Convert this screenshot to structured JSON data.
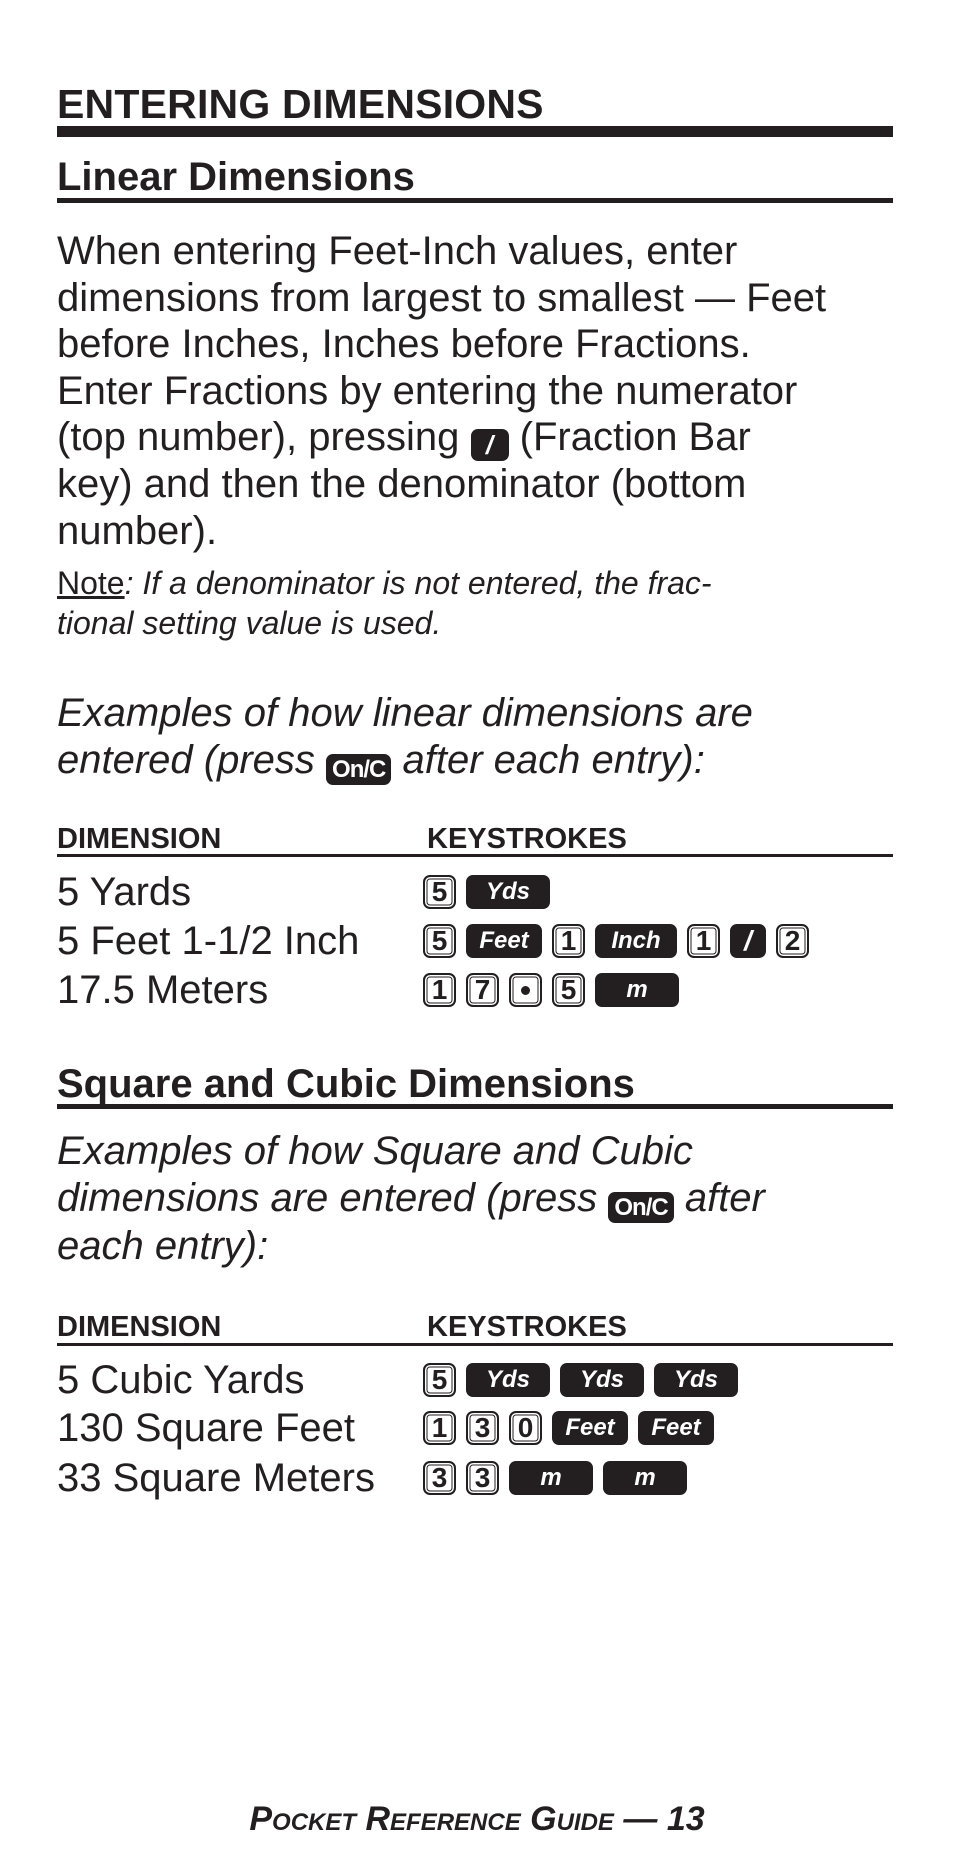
{
  "page": {
    "title": "ENTERING DIMENSIONS",
    "linear": {
      "heading": "Linear Dimensions",
      "paragraph": [
        "When entering Feet-Inch values, enter",
        "dimensions from largest to smallest — Feet",
        "before Inches, Inches before Fractions.",
        "Enter Fractions by entering the numerator",
        {
          "before": "(top number), pressing ",
          "key": "/",
          "after": " (Fraction Bar"
        },
        "key) and then the denominator (bottom",
        "number)."
      ],
      "note_label": "Note",
      "note_lines": [
        ": If a denominator is not entered, the frac-",
        "tional setting value is used."
      ],
      "examples_line1": "Examples of how linear dimensions are",
      "examples_line2_before": "entered (press ",
      "examples_key": "On/C",
      "examples_line2_after": " after each entry):",
      "table_header": {
        "dimension": "DIMENSION",
        "keystrokes": "KEYSTROKES"
      },
      "rows": [
        {
          "dimension": "5 Yards",
          "keys": [
            {
              "label": "5",
              "type": "digit"
            },
            {
              "label": "Yds",
              "type": "unit"
            }
          ]
        },
        {
          "dimension": "5 Feet 1-1/2 Inch",
          "keys": [
            {
              "label": "5",
              "type": "digit"
            },
            {
              "label": "Feet",
              "type": "unit"
            },
            {
              "label": "1",
              "type": "digit"
            },
            {
              "label": "Inch",
              "type": "unit"
            },
            {
              "label": "1",
              "type": "digit"
            },
            {
              "label": "/",
              "type": "fraction"
            },
            {
              "label": "2",
              "type": "digit"
            }
          ]
        },
        {
          "dimension": "17.5 Meters",
          "keys": [
            {
              "label": "1",
              "type": "digit"
            },
            {
              "label": "7",
              "type": "digit"
            },
            {
              "label": "•",
              "type": "decimal"
            },
            {
              "label": "5",
              "type": "digit"
            },
            {
              "label": "m",
              "type": "unit"
            }
          ]
        }
      ]
    },
    "square_cubic": {
      "heading": "Square and Cubic Dimensions",
      "examples_line1": "Examples of how Square and Cubic",
      "examples_line2_before": "dimensions are entered (press ",
      "examples_key": "On/C",
      "examples_line2_after": " after",
      "examples_line3": "each entry):",
      "table_header": {
        "dimension": "DIMENSION",
        "keystrokes": "KEYSTROKES"
      },
      "rows": [
        {
          "dimension": "5 Cubic Yards",
          "keys": [
            {
              "label": "5",
              "type": "digit"
            },
            {
              "label": "Yds",
              "type": "unit"
            },
            {
              "label": "Yds",
              "type": "unit"
            },
            {
              "label": "Yds",
              "type": "unit"
            }
          ]
        },
        {
          "dimension": "130 Square Feet",
          "keys": [
            {
              "label": "1",
              "type": "digit"
            },
            {
              "label": "3",
              "type": "digit"
            },
            {
              "label": "0",
              "type": "digit"
            },
            {
              "label": "Feet",
              "type": "unit"
            },
            {
              "label": "Feet",
              "type": "unit"
            }
          ]
        },
        {
          "dimension": "33 Square Meters",
          "keys": [
            {
              "label": "3",
              "type": "digit"
            },
            {
              "label": "3",
              "type": "digit"
            },
            {
              "label": "m",
              "type": "unit"
            },
            {
              "label": "m",
              "type": "unit"
            }
          ]
        }
      ]
    },
    "footer": "Pocket Reference Guide — 13"
  },
  "colors": {
    "ink": "#231f20",
    "paper": "#ffffff"
  }
}
